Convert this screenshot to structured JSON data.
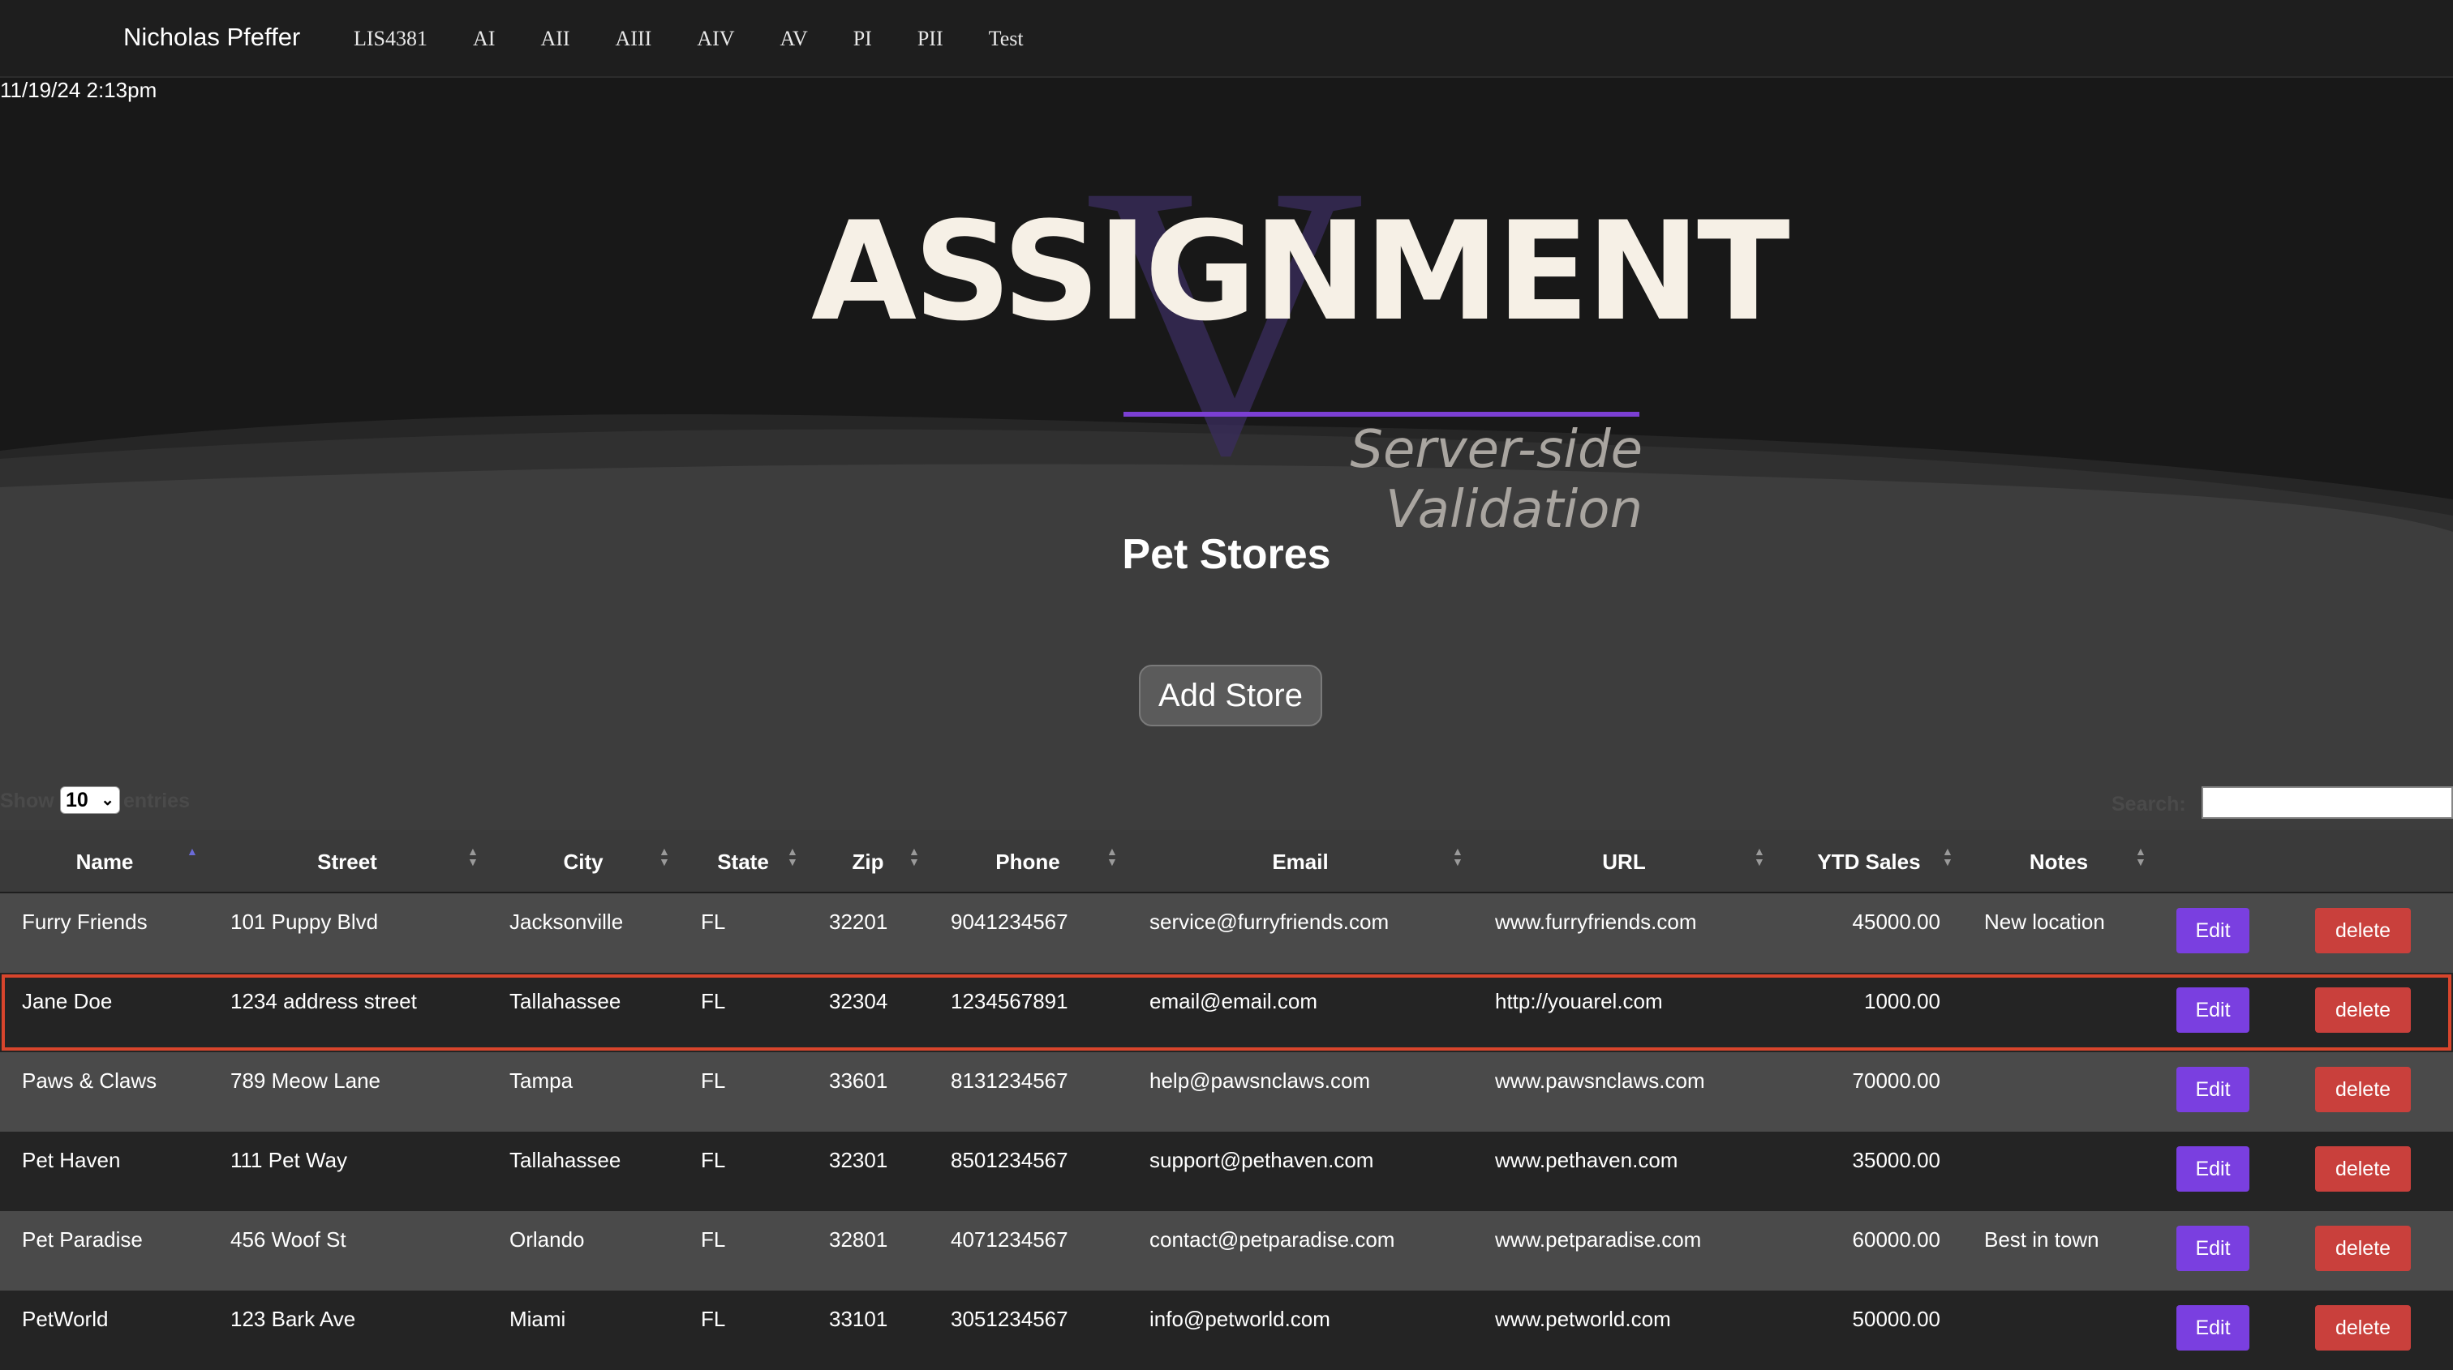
{
  "navbar": {
    "brand": "Nicholas Pfeffer",
    "links": [
      "LIS4381",
      "AI",
      "AII",
      "AIII",
      "AIV",
      "AV",
      "PI",
      "PII",
      "Test"
    ]
  },
  "timestamp": "11/19/24 2:13pm",
  "hero": {
    "logo_letter": "V",
    "title": "ASSIGNMENT",
    "subtitle": "Server-side Validation",
    "accent_color": "#7b3fd3"
  },
  "page_title": "Pet Stores",
  "add_button": "Add Store",
  "table_controls": {
    "show_label": "Show",
    "page_size": "10",
    "entries_label": "entries",
    "search_label": "Search:",
    "search_value": ""
  },
  "table": {
    "columns": [
      "Name",
      "Street",
      "City",
      "State",
      "Zip",
      "Phone",
      "Email",
      "URL",
      "YTD Sales",
      "Notes"
    ],
    "sorted_column": "Name",
    "edit_label": "Edit",
    "delete_label": "delete",
    "rows": [
      [
        "Furry Friends",
        "101 Puppy Blvd",
        "Jacksonville",
        "FL",
        "32201",
        "9041234567",
        "service@furryfriends.com",
        "www.furryfriends.com",
        "45000.00",
        "New location"
      ],
      [
        "Jane Doe",
        "1234 address street",
        "Tallahassee",
        "FL",
        "32304",
        "1234567891",
        "email@email.com",
        "http://youarel.com",
        "1000.00",
        ""
      ],
      [
        "Paws & Claws",
        "789 Meow Lane",
        "Tampa",
        "FL",
        "33601",
        "8131234567",
        "help@pawsnclaws.com",
        "www.pawsnclaws.com",
        "70000.00",
        ""
      ],
      [
        "Pet Haven",
        "111 Pet Way",
        "Tallahassee",
        "FL",
        "32301",
        "8501234567",
        "support@pethaven.com",
        "www.pethaven.com",
        "35000.00",
        ""
      ],
      [
        "Pet Paradise",
        "456 Woof St",
        "Orlando",
        "FL",
        "32801",
        "4071234567",
        "contact@petparadise.com",
        "www.petparadise.com",
        "60000.00",
        "Best in town"
      ],
      [
        "PetWorld",
        "123 Bark Ave",
        "Miami",
        "FL",
        "33101",
        "3051234567",
        "info@petworld.com",
        "www.petworld.com",
        "50000.00",
        ""
      ]
    ],
    "selected_row": "Jane Doe",
    "colors": {
      "edit": "#7a3fe0",
      "delete": "#c9403c",
      "selected_outline": "#d8452c"
    }
  }
}
